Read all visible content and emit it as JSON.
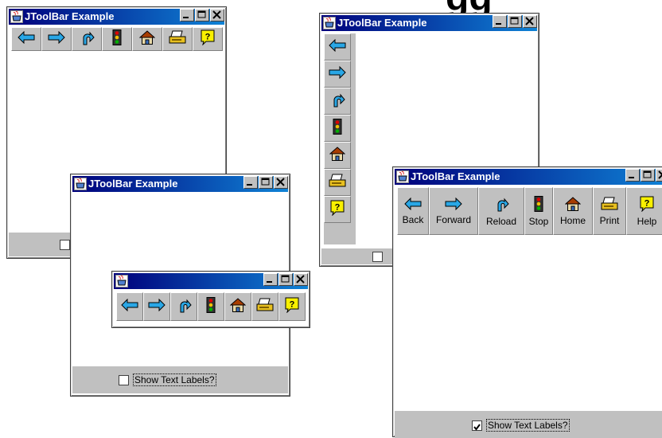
{
  "windows": [
    {
      "title": "JToolBar Example"
    },
    {
      "title": "JToolBar Example",
      "checkbox_label": "Show Text Labels?",
      "checked": false
    },
    {
      "title": "JToolBar Example"
    },
    {
      "title": "JToolBar Example",
      "checkbox_label": "Show Text Labels?",
      "checked": true
    }
  ],
  "floating_toolbar": {
    "title": ""
  },
  "toolbar_buttons": [
    {
      "label": "Back",
      "icon": "arrow-left-icon"
    },
    {
      "label": "Forward",
      "icon": "arrow-right-icon"
    },
    {
      "label": "Reload",
      "icon": "reload-icon"
    },
    {
      "label": "Stop",
      "icon": "traffic-light-icon"
    },
    {
      "label": "Home",
      "icon": "home-icon"
    },
    {
      "label": "Print",
      "icon": "print-icon"
    },
    {
      "label": "Help",
      "icon": "help-icon"
    }
  ],
  "title_buttons": [
    "minimize",
    "maximize",
    "close"
  ],
  "colors": {
    "titlebar_start": "#00007b",
    "titlebar_end": "#0f83d6",
    "face": "#c0c0c0",
    "arrow": "#29a7e6"
  }
}
